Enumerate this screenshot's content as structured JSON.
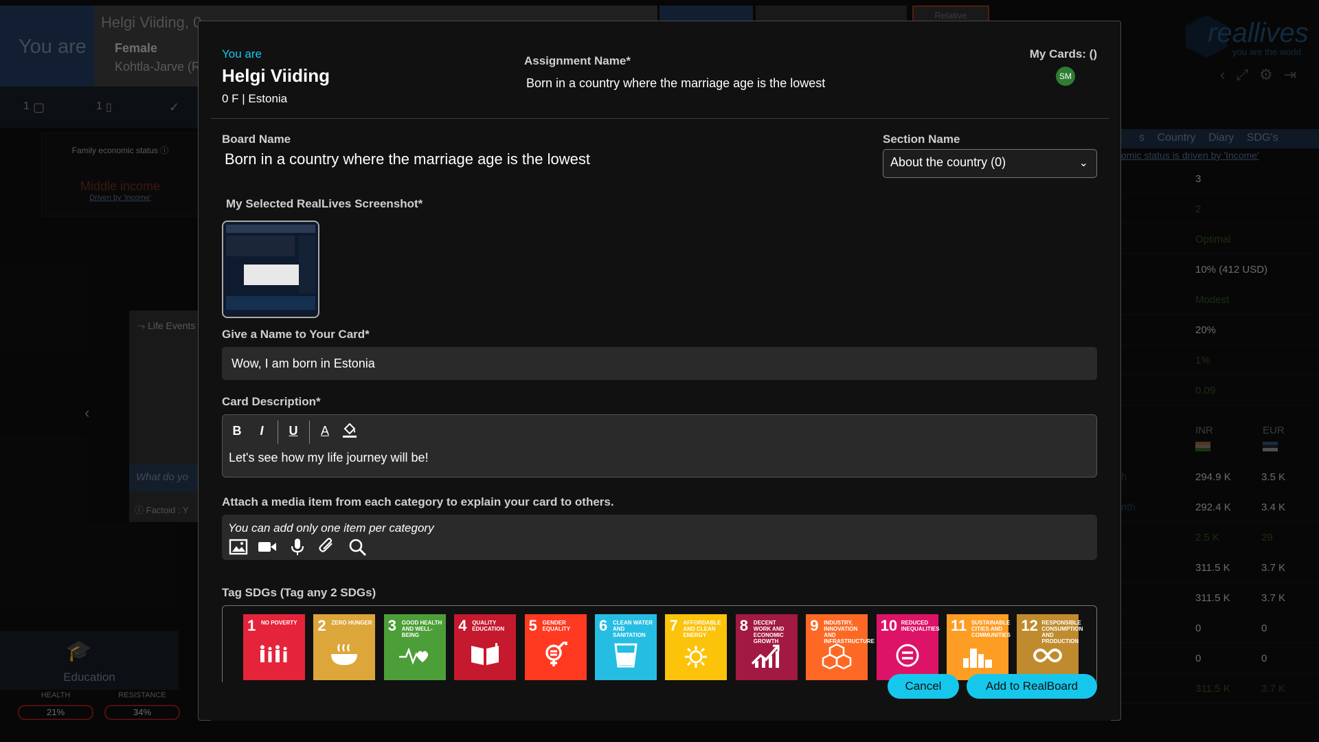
{
  "background": {
    "you_are": "You are",
    "profile": {
      "name": "Helgi Viiding, 0",
      "gender": "Female",
      "city": "Kohtla-Jarve (Ru"
    },
    "tab_relative": "Relative",
    "iconbar": [
      "1",
      "1"
    ],
    "econ": {
      "title": "Family economic status",
      "value": "Middle income",
      "sub": "Driven by 'Income'"
    },
    "life_events": "Life Events",
    "what_do_you": "What do yo",
    "factoid": "Factoid : Y",
    "education": "Education",
    "stats": [
      {
        "label": "HEALTH",
        "value": "21%"
      },
      {
        "label": "RESISTANCE",
        "value": "34%"
      }
    ],
    "logo": {
      "word": "reallives",
      "tagline": "you are the world"
    },
    "right_tabs": [
      "s",
      "Country",
      "Diary",
      "SDG's"
    ],
    "right_note": "omic status is driven by 'Income'",
    "right_rows": [
      {
        "a": "3",
        "b": "",
        "color": "#bbbbbb"
      },
      {
        "a": "2",
        "b": "",
        "color": "#2f4f1f"
      },
      {
        "a": "Optimal",
        "b": "",
        "color": "#2f4f1f"
      },
      {
        "a": "10% (412 USD)",
        "b": "",
        "color": "#bbbbbb"
      },
      {
        "a": "Modest",
        "b": "",
        "color": "#2f4f1f"
      },
      {
        "a": "20%",
        "b": "",
        "color": "#bbbbbb"
      },
      {
        "a": "1%",
        "b": "",
        "color": "#2f4f1f"
      },
      {
        "a": "0.09",
        "b": "",
        "color": "#2f4f1f"
      }
    ],
    "currency": {
      "a": "INR",
      "b": "EUR"
    },
    "money_rows": [
      {
        "l": "h",
        "a": "294.9 K",
        "b": "3.5 K",
        "color": "#bbbbbb"
      },
      {
        "l": "nth",
        "a": "292.4 K",
        "b": "3.4 K",
        "color": "#bbbbbb"
      },
      {
        "l": "",
        "a": "2.5 K",
        "b": "29",
        "color": "#2f4f1f"
      },
      {
        "l": "",
        "a": "311.5 K",
        "b": "3.7 K",
        "color": "#bbbbbb"
      },
      {
        "l": "",
        "a": "311.5 K",
        "b": "3.7 K",
        "color": "#bbbbbb"
      },
      {
        "l": "",
        "a": "0",
        "b": "0",
        "color": "#bbbbbb"
      },
      {
        "l": "",
        "a": "0",
        "b": "0",
        "color": "#bbbbbb"
      },
      {
        "l": "",
        "a": "311.5 K",
        "b": "3.7 K",
        "color": "#2f4f1f"
      }
    ]
  },
  "modal": {
    "you_are": "You are",
    "name": "Helgi Viiding",
    "meta": "0 F | Estonia",
    "assignment_label": "Assignment Name*",
    "assignment_value": "Born in a country where the marriage age is the lowest",
    "my_cards": "My Cards: ()",
    "avatar": "SM",
    "board_label": "Board Name",
    "board_value": "Born in a country where the marriage age is the lowest",
    "section_label": "Section Name",
    "section_value": "About the country (0)",
    "screenshot_label": "My Selected RealLives Screenshot*",
    "card_name_label": "Give a Name to Your Card*",
    "card_name_value": "Wow, I am born in Estonia",
    "desc_label": "Card Description*",
    "desc_value": "Let's see how my life journey will be!",
    "toolbar": [
      "B",
      "I",
      "U",
      "A"
    ],
    "media_label": "Attach a media item from each category to explain your card to others.",
    "media_note": "You can add only one item per category",
    "sdg_label": "Tag SDGs (Tag any 2 SDGs)",
    "sdgs": [
      {
        "n": "1",
        "t": "No Poverty",
        "color": "#e5243b",
        "icon": "people"
      },
      {
        "n": "2",
        "t": "Zero Hunger",
        "color": "#dda63a",
        "icon": "bowl"
      },
      {
        "n": "3",
        "t": "Good Health and Well-Being",
        "color": "#4c9f38",
        "icon": "pulse"
      },
      {
        "n": "4",
        "t": "Quality Education",
        "color": "#c5192d",
        "icon": "book"
      },
      {
        "n": "5",
        "t": "Gender Equality",
        "color": "#ff3a21",
        "icon": "gender"
      },
      {
        "n": "6",
        "t": "Clean Water and Sanitation",
        "color": "#26bde2",
        "icon": "glass"
      },
      {
        "n": "7",
        "t": "Affordable and Clean Energy",
        "color": "#fcc30b",
        "icon": "sun"
      },
      {
        "n": "8",
        "t": "Decent Work and Economic Growth",
        "color": "#a21942",
        "icon": "chart"
      },
      {
        "n": "9",
        "t": "Industry, Innovation and Infrastructure",
        "color": "#fd6925",
        "icon": "cubes"
      },
      {
        "n": "10",
        "t": "Reduced Inequalities",
        "color": "#dd1367",
        "icon": "equal"
      },
      {
        "n": "11",
        "t": "Sustainable Cities and Communities",
        "color": "#fd9d24",
        "icon": "city"
      },
      {
        "n": "12",
        "t": "Responsible Consumption and Production",
        "color": "#bf8b2e",
        "icon": "infinity"
      }
    ],
    "cancel": "Cancel",
    "add": "Add to RealBoard"
  }
}
